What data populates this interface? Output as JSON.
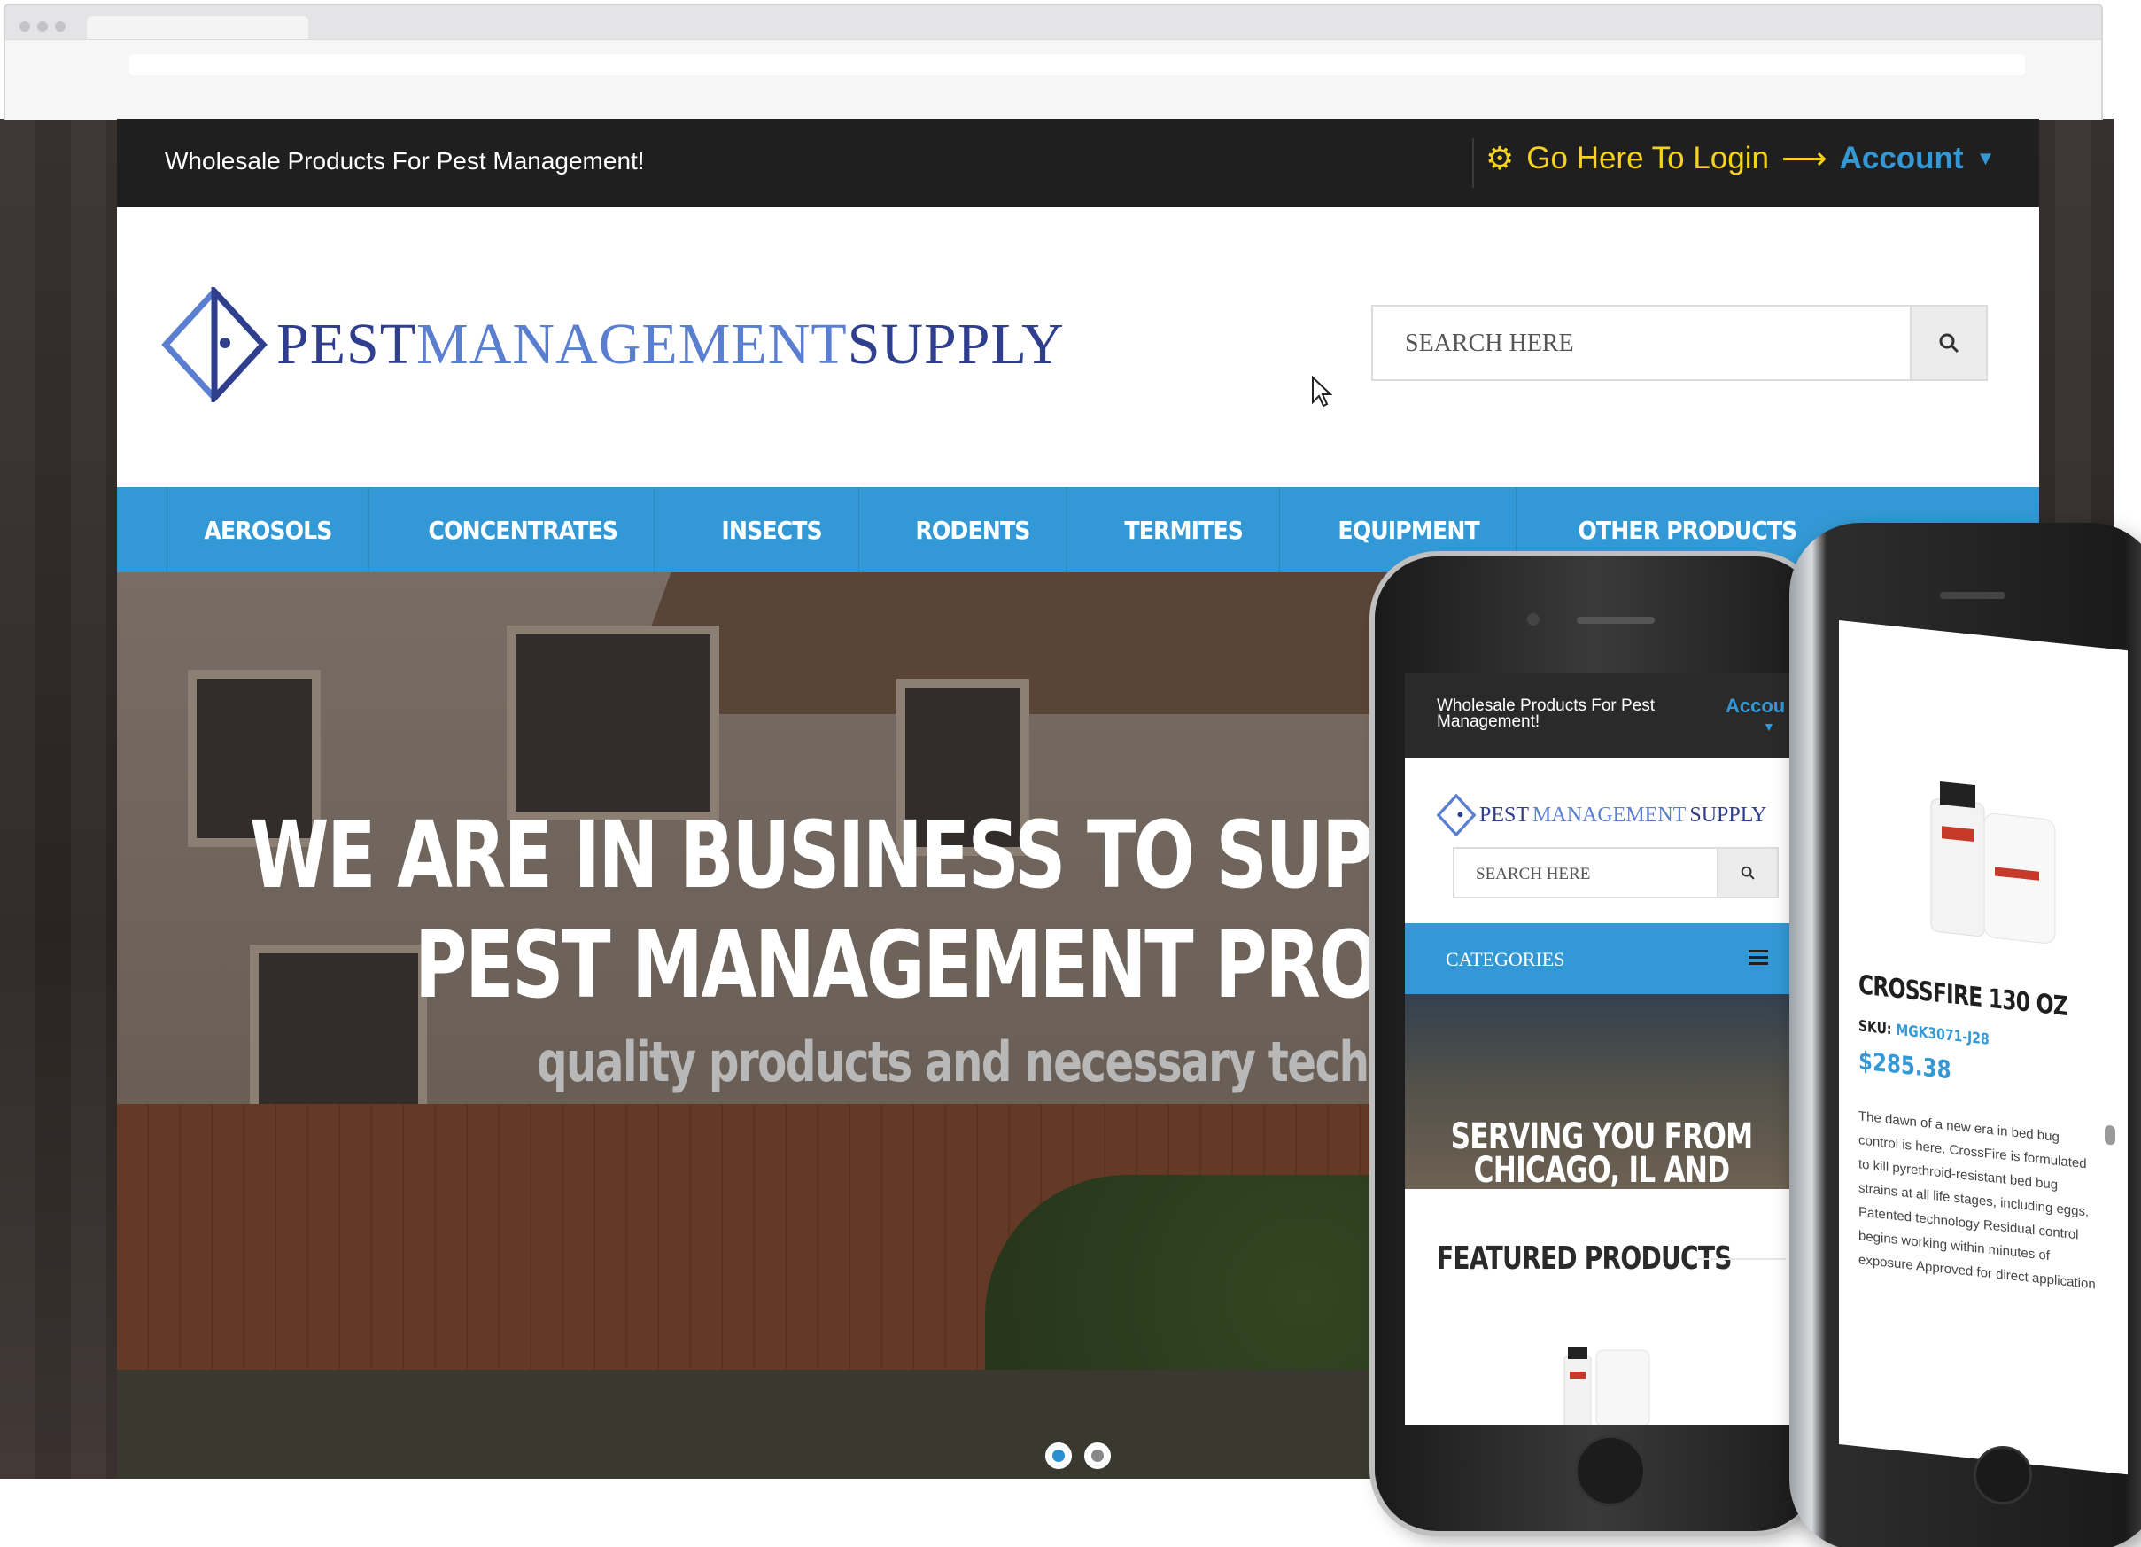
{
  "site": {
    "tagline": "Wholesale Products For Pest Management!",
    "login_text": "Go Here To Login",
    "account_label": "Account",
    "logo": {
      "word1": "PEST",
      "word2": "MANAGEMENT",
      "word3": "SUPPLY"
    },
    "search": {
      "placeholder": "SEARCH HERE"
    },
    "nav": [
      {
        "label": "AEROSOLS"
      },
      {
        "label": "CONCENTRATES"
      },
      {
        "label": "INSECTS"
      },
      {
        "label": "RODENTS"
      },
      {
        "label": "TERMITES"
      },
      {
        "label": "EQUIPMENT"
      },
      {
        "label": "OTHER PRODUCTS"
      }
    ],
    "hero": {
      "line1": "WE ARE IN BUSINESS TO SUPP",
      "line2": "PEST MANAGEMENT PROF",
      "line3": "quality products and necessary technic",
      "slides_total": 2,
      "slide_active": 1
    }
  },
  "mobile": {
    "tagline": "Wholesale Products For Pest Management!",
    "account_label": "Accou",
    "logo": {
      "word1": "PEST",
      "word2": "MANAGEMENT",
      "word3": "SUPPLY"
    },
    "search_placeholder": "SEARCH HERE",
    "categories_label": "CATEGORIES",
    "hero": {
      "line1": "SERVING YOU FROM",
      "line2": "CHICAGO, IL AND NORTH"
    },
    "featured_title": "FEATURED PRODUCTS"
  },
  "product": {
    "title": "CROSSFIRE 130 OZ",
    "sku_label": "SKU:",
    "sku": "MGK3071-J28",
    "price": "$285.38",
    "description": "The dawn of a new era in bed bug control is here. CrossFire is formulated to kill pyrethroid-resistant bed bug strains at all life stages, including eggs. Patented technology Residual control begins working within minutes of exposure Approved for direct application"
  },
  "colors": {
    "accent": "#3399d6",
    "login_yellow": "#f6d21d",
    "topbar": "#1f1f1f"
  },
  "icons": {
    "gear": "gear-icon",
    "arrow": "arrow-right-icon",
    "caret": "caret-down-icon",
    "search": "search-icon",
    "menu": "hamburger-menu-icon",
    "cursor": "mouse-cursor-icon"
  }
}
